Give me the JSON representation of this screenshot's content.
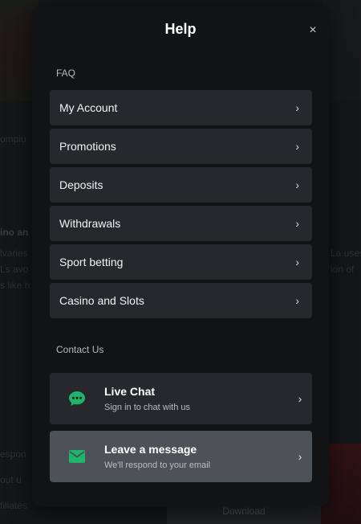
{
  "modal": {
    "title": "Help",
    "close_icon": "×"
  },
  "faq": {
    "section_label": "FAQ",
    "items": [
      {
        "label": "My Account"
      },
      {
        "label": "Promotions"
      },
      {
        "label": "Deposits"
      },
      {
        "label": "Withdrawals"
      },
      {
        "label": "Sport betting"
      },
      {
        "label": "Casino and Slots"
      }
    ],
    "chevron": "›"
  },
  "contact": {
    "section_label": "Contact Us",
    "live_chat": {
      "title": "Live Chat",
      "subtitle": "Sign in to chat with us",
      "icon": "chat-bubble-icon"
    },
    "message": {
      "title": "Leave a message",
      "subtitle": "We'll respond to your email",
      "icon": "envelope-icon"
    }
  },
  "colors": {
    "accent": "#1fb46b",
    "modal_bg": "#121314",
    "item_bg": "#26282b",
    "highlight_bg": "#4c5257"
  },
  "background": {
    "text_fragments": [
      "ompiu",
      "ino an",
      "lvaries",
      "Ls avo",
      "s like h",
      "La uses",
      "ion of",
      "espon",
      "out u",
      "filiates"
    ],
    "download_button": "Download"
  }
}
